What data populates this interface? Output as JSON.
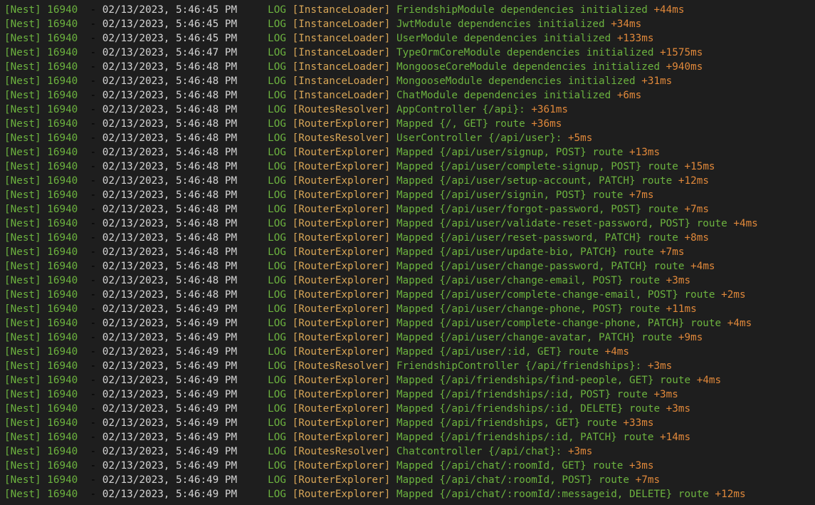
{
  "colors": {
    "background": "#1e1e1e",
    "nest_green": "#6cb33f",
    "timestamp_white": "#d4d4d4",
    "context_orange": "#d8a657",
    "elapsed_orange": "#e0883a"
  },
  "lines": [
    {
      "prefix": "[Nest] 16940",
      "date": "02/13/2023, 5:46:45 PM",
      "level": "LOG",
      "context": "[InstanceLoader]",
      "message": "FriendshipModule dependencies initialized",
      "elapsed": "+44ms"
    },
    {
      "prefix": "[Nest] 16940",
      "date": "02/13/2023, 5:46:45 PM",
      "level": "LOG",
      "context": "[InstanceLoader]",
      "message": "JwtModule dependencies initialized",
      "elapsed": "+34ms"
    },
    {
      "prefix": "[Nest] 16940",
      "date": "02/13/2023, 5:46:45 PM",
      "level": "LOG",
      "context": "[InstanceLoader]",
      "message": "UserModule dependencies initialized",
      "elapsed": "+133ms"
    },
    {
      "prefix": "[Nest] 16940",
      "date": "02/13/2023, 5:46:47 PM",
      "level": "LOG",
      "context": "[InstanceLoader]",
      "message": "TypeOrmCoreModule dependencies initialized",
      "elapsed": "+1575ms"
    },
    {
      "prefix": "[Nest] 16940",
      "date": "02/13/2023, 5:46:48 PM",
      "level": "LOG",
      "context": "[InstanceLoader]",
      "message": "MongooseCoreModule dependencies initialized",
      "elapsed": "+940ms"
    },
    {
      "prefix": "[Nest] 16940",
      "date": "02/13/2023, 5:46:48 PM",
      "level": "LOG",
      "context": "[InstanceLoader]",
      "message": "MongooseModule dependencies initialized",
      "elapsed": "+31ms"
    },
    {
      "prefix": "[Nest] 16940",
      "date": "02/13/2023, 5:46:48 PM",
      "level": "LOG",
      "context": "[InstanceLoader]",
      "message": "ChatModule dependencies initialized",
      "elapsed": "+6ms"
    },
    {
      "prefix": "[Nest] 16940",
      "date": "02/13/2023, 5:46:48 PM",
      "level": "LOG",
      "context": "[RoutesResolver]",
      "message": "AppController {/api}:",
      "elapsed": "+361ms"
    },
    {
      "prefix": "[Nest] 16940",
      "date": "02/13/2023, 5:46:48 PM",
      "level": "LOG",
      "context": "[RouterExplorer]",
      "message": "Mapped {/, GET} route",
      "elapsed": "+36ms"
    },
    {
      "prefix": "[Nest] 16940",
      "date": "02/13/2023, 5:46:48 PM",
      "level": "LOG",
      "context": "[RoutesResolver]",
      "message": "UserController {/api/user}:",
      "elapsed": "+5ms"
    },
    {
      "prefix": "[Nest] 16940",
      "date": "02/13/2023, 5:46:48 PM",
      "level": "LOG",
      "context": "[RouterExplorer]",
      "message": "Mapped {/api/user/signup, POST} route",
      "elapsed": "+13ms"
    },
    {
      "prefix": "[Nest] 16940",
      "date": "02/13/2023, 5:46:48 PM",
      "level": "LOG",
      "context": "[RouterExplorer]",
      "message": "Mapped {/api/user/complete-signup, POST} route",
      "elapsed": "+15ms"
    },
    {
      "prefix": "[Nest] 16940",
      "date": "02/13/2023, 5:46:48 PM",
      "level": "LOG",
      "context": "[RouterExplorer]",
      "message": "Mapped {/api/user/setup-account, PATCH} route",
      "elapsed": "+12ms"
    },
    {
      "prefix": "[Nest] 16940",
      "date": "02/13/2023, 5:46:48 PM",
      "level": "LOG",
      "context": "[RouterExplorer]",
      "message": "Mapped {/api/user/signin, POST} route",
      "elapsed": "+7ms"
    },
    {
      "prefix": "[Nest] 16940",
      "date": "02/13/2023, 5:46:48 PM",
      "level": "LOG",
      "context": "[RouterExplorer]",
      "message": "Mapped {/api/user/forgot-password, POST} route",
      "elapsed": "+7ms"
    },
    {
      "prefix": "[Nest] 16940",
      "date": "02/13/2023, 5:46:48 PM",
      "level": "LOG",
      "context": "[RouterExplorer]",
      "message": "Mapped {/api/user/validate-reset-password, POST} route",
      "elapsed": "+4ms"
    },
    {
      "prefix": "[Nest] 16940",
      "date": "02/13/2023, 5:46:48 PM",
      "level": "LOG",
      "context": "[RouterExplorer]",
      "message": "Mapped {/api/user/reset-password, PATCH} route",
      "elapsed": "+8ms"
    },
    {
      "prefix": "[Nest] 16940",
      "date": "02/13/2023, 5:46:48 PM",
      "level": "LOG",
      "context": "[RouterExplorer]",
      "message": "Mapped {/api/user/update-bio, PATCH} route",
      "elapsed": "+7ms"
    },
    {
      "prefix": "[Nest] 16940",
      "date": "02/13/2023, 5:46:48 PM",
      "level": "LOG",
      "context": "[RouterExplorer]",
      "message": "Mapped {/api/user/change-password, PATCH} route",
      "elapsed": "+4ms"
    },
    {
      "prefix": "[Nest] 16940",
      "date": "02/13/2023, 5:46:48 PM",
      "level": "LOG",
      "context": "[RouterExplorer]",
      "message": "Mapped {/api/user/change-email, POST} route",
      "elapsed": "+3ms"
    },
    {
      "prefix": "[Nest] 16940",
      "date": "02/13/2023, 5:46:48 PM",
      "level": "LOG",
      "context": "[RouterExplorer]",
      "message": "Mapped {/api/user/complete-change-email, POST} route",
      "elapsed": "+2ms"
    },
    {
      "prefix": "[Nest] 16940",
      "date": "02/13/2023, 5:46:49 PM",
      "level": "LOG",
      "context": "[RouterExplorer]",
      "message": "Mapped {/api/user/change-phone, POST} route",
      "elapsed": "+11ms"
    },
    {
      "prefix": "[Nest] 16940",
      "date": "02/13/2023, 5:46:49 PM",
      "level": "LOG",
      "context": "[RouterExplorer]",
      "message": "Mapped {/api/user/complete-change-phone, PATCH} route",
      "elapsed": "+4ms"
    },
    {
      "prefix": "[Nest] 16940",
      "date": "02/13/2023, 5:46:49 PM",
      "level": "LOG",
      "context": "[RouterExplorer]",
      "message": "Mapped {/api/user/change-avatar, PATCH} route",
      "elapsed": "+9ms"
    },
    {
      "prefix": "[Nest] 16940",
      "date": "02/13/2023, 5:46:49 PM",
      "level": "LOG",
      "context": "[RouterExplorer]",
      "message": "Mapped {/api/user/:id, GET} route",
      "elapsed": "+4ms"
    },
    {
      "prefix": "[Nest] 16940",
      "date": "02/13/2023, 5:46:49 PM",
      "level": "LOG",
      "context": "[RoutesResolver]",
      "message": "FriendshipController {/api/friendships}:",
      "elapsed": "+3ms"
    },
    {
      "prefix": "[Nest] 16940",
      "date": "02/13/2023, 5:46:49 PM",
      "level": "LOG",
      "context": "[RouterExplorer]",
      "message": "Mapped {/api/friendships/find-people, GET} route",
      "elapsed": "+4ms"
    },
    {
      "prefix": "[Nest] 16940",
      "date": "02/13/2023, 5:46:49 PM",
      "level": "LOG",
      "context": "[RouterExplorer]",
      "message": "Mapped {/api/friendships/:id, POST} route",
      "elapsed": "+3ms"
    },
    {
      "prefix": "[Nest] 16940",
      "date": "02/13/2023, 5:46:49 PM",
      "level": "LOG",
      "context": "[RouterExplorer]",
      "message": "Mapped {/api/friendships/:id, DELETE} route",
      "elapsed": "+3ms"
    },
    {
      "prefix": "[Nest] 16940",
      "date": "02/13/2023, 5:46:49 PM",
      "level": "LOG",
      "context": "[RouterExplorer]",
      "message": "Mapped {/api/friendships, GET} route",
      "elapsed": "+33ms"
    },
    {
      "prefix": "[Nest] 16940",
      "date": "02/13/2023, 5:46:49 PM",
      "level": "LOG",
      "context": "[RouterExplorer]",
      "message": "Mapped {/api/friendships/:id, PATCH} route",
      "elapsed": "+14ms"
    },
    {
      "prefix": "[Nest] 16940",
      "date": "02/13/2023, 5:46:49 PM",
      "level": "LOG",
      "context": "[RoutesResolver]",
      "message": "Chatcontroller {/api/chat}:",
      "elapsed": "+3ms"
    },
    {
      "prefix": "[Nest] 16940",
      "date": "02/13/2023, 5:46:49 PM",
      "level": "LOG",
      "context": "[RouterExplorer]",
      "message": "Mapped {/api/chat/:roomId, GET} route",
      "elapsed": "+3ms"
    },
    {
      "prefix": "[Nest] 16940",
      "date": "02/13/2023, 5:46:49 PM",
      "level": "LOG",
      "context": "[RouterExplorer]",
      "message": "Mapped {/api/chat/:roomId, POST} route",
      "elapsed": "+7ms"
    },
    {
      "prefix": "[Nest] 16940",
      "date": "02/13/2023, 5:46:49 PM",
      "level": "LOG",
      "context": "[RouterExplorer]",
      "message": "Mapped {/api/chat/:roomId/:messageid, DELETE} route",
      "elapsed": "+12ms"
    }
  ]
}
